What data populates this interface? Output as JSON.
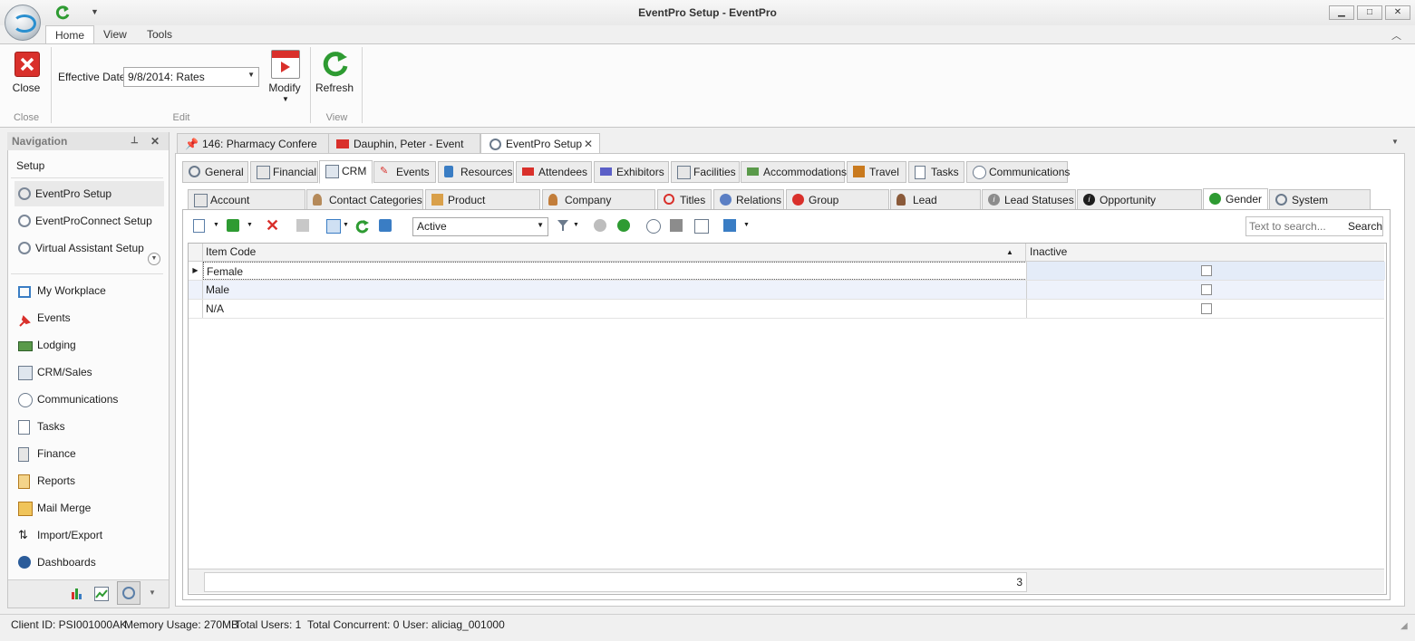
{
  "window": {
    "title": "EventPro Setup - EventPro",
    "minimize": "▁",
    "maximize": "□",
    "close": "✕"
  },
  "ribbon": {
    "tabs": [
      "Home",
      "View",
      "Tools"
    ],
    "close_label": "Close",
    "effective_date_label": "Effective Date",
    "effective_date_value": "9/8/2014: Rates",
    "modify_label": "Modify",
    "refresh_label": "Refresh",
    "groups": {
      "close": "Close",
      "edit": "Edit",
      "view": "View"
    }
  },
  "navigation": {
    "title": "Navigation",
    "section": "Setup",
    "setup_items": [
      "EventPro Setup",
      "EventProConnect Setup",
      "Virtual Assistant Setup"
    ],
    "items": [
      "My Workplace",
      "Events",
      "Lodging",
      "CRM/Sales",
      "Communications",
      "Tasks",
      "Finance",
      "Reports",
      "Mail Merge",
      "Import/Export",
      "Dashboards"
    ]
  },
  "doc_tabs": [
    "146: Pharmacy Confere",
    "Dauphin, Peter  - Event",
    "EventPro Setup"
  ],
  "setup_tabs": [
    "General",
    "Financial",
    "CRM",
    "Events",
    "Resources",
    "Attendees",
    "Exhibitors",
    "Facilities",
    "Accommodations",
    "Travel",
    "Tasks",
    "Communications"
  ],
  "crm_tabs": [
    "Account Categories",
    "Contact Categories",
    "Product Categories",
    "Company Positions",
    "Titles",
    "Relations",
    "Group Discounts",
    "Lead Sources",
    "Lead Statuses",
    "Opportunity Statuses",
    "Gender",
    "System Settings"
  ],
  "toolbar": {
    "filter_value": "Active",
    "search_placeholder": "Text to search...",
    "search_button": "Search"
  },
  "grid": {
    "columns": [
      "Item Code",
      "Inactive"
    ],
    "rows": [
      {
        "code": "Female",
        "inactive": false
      },
      {
        "code": "Male",
        "inactive": false
      },
      {
        "code": "N/A",
        "inactive": false
      }
    ],
    "count": "3"
  },
  "status": {
    "client_id": "Client ID: PSI001000AK",
    "memory": "Memory Usage: 270MB",
    "total_users": "Total Users: 1",
    "total_concurrent": "Total Concurrent: 0",
    "user": "User: aliciag_001000"
  },
  "colors": {
    "accent_blue": "#2a8fcf",
    "close_red": "#d9302b",
    "refresh_green": "#2e9b32"
  }
}
